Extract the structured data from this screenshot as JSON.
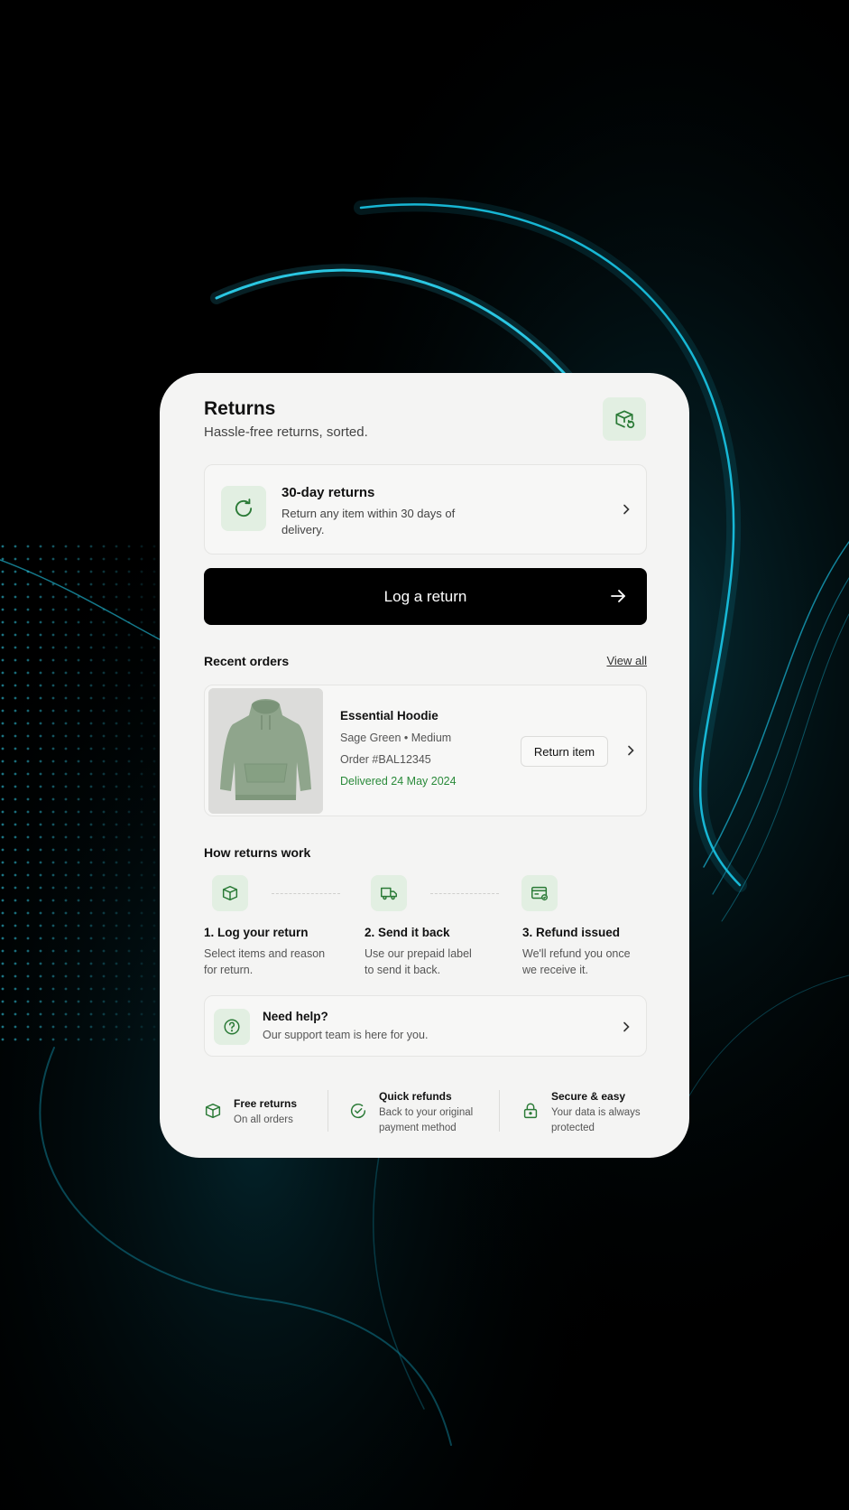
{
  "header": {
    "title": "Returns",
    "subtitle": "Hassle-free returns, sorted."
  },
  "promo": {
    "title": "30-day returns",
    "text": "Return any item within 30 days of delivery."
  },
  "cta": {
    "label": "Log a return"
  },
  "recent_orders": {
    "title": "Recent orders",
    "view_all": "View all",
    "order": {
      "name": "Essential Hoodie",
      "variant": "Sage Green  •  Medium",
      "order_number": "Order #BAL12345",
      "status": "Delivered 24 May 2024",
      "action": "Return item"
    }
  },
  "how_it_works": {
    "title": "How returns work",
    "steps": [
      {
        "title": "1. Log your return",
        "text": "Select items and reason for return.",
        "icon": "box-icon"
      },
      {
        "title": "2. Send it back",
        "text": "Use our prepaid label to send it back.",
        "icon": "truck-icon"
      },
      {
        "title": "3. Refund issued",
        "text": "We'll refund you once we receive it.",
        "icon": "card-icon"
      }
    ]
  },
  "help": {
    "title": "Need help?",
    "text": "Our support team is here for you."
  },
  "features": [
    {
      "title": "Free returns",
      "text": "On all orders",
      "icon": "box-icon"
    },
    {
      "title": "Quick refunds",
      "text": "Back to your original payment method",
      "icon": "check-circle-icon"
    },
    {
      "title": "Secure & easy",
      "text": "Your data is always protected",
      "icon": "lock-icon"
    }
  ],
  "colors": {
    "accent_green": "#2a8a3a",
    "badge_bg": "#e2efe2",
    "card_bg": "#f4f4f3",
    "cta_bg": "#000000",
    "glow": "#19d4f0"
  }
}
